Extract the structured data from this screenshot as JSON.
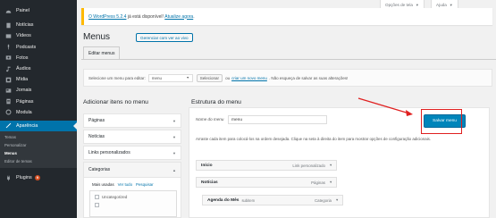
{
  "sidebar": {
    "items": [
      {
        "label": "Painel",
        "icon": "dashboard-icon"
      },
      {
        "label": "Notícias",
        "icon": "pin-icon"
      },
      {
        "label": "Vídeos",
        "icon": "video-icon"
      },
      {
        "label": "Podcasts",
        "icon": "microphone-icon"
      },
      {
        "label": "Fotos",
        "icon": "photo-icon"
      },
      {
        "label": "Áudios",
        "icon": "music-icon"
      },
      {
        "label": "Mídia",
        "icon": "media-icon"
      },
      {
        "label": "Jornais",
        "icon": "newspaper-icon"
      },
      {
        "label": "Páginas",
        "icon": "pages-icon"
      },
      {
        "label": "Modula",
        "icon": "gallery-icon"
      },
      {
        "label": "Aparência",
        "icon": "paintbrush-icon"
      }
    ],
    "submenu": [
      "Temas",
      "Personalizar",
      "Menus",
      "Editor de temas"
    ],
    "plugins": {
      "label": "Plugins",
      "badge": "9"
    }
  },
  "top_tabs": {
    "screen_options": "Opções de tela",
    "help": "Ajuda"
  },
  "notice": {
    "link": "O WordPress 5.2.4",
    "text_mid": " já está disponível! ",
    "action": "Atualize agora",
    "end": "."
  },
  "page": {
    "title": "Menus",
    "preview_button": "Gerenciar com ver ao vivo"
  },
  "tabs": {
    "edit_menus": "Editar menus"
  },
  "select_bar": {
    "prefix": "Selecione um menu para editar:",
    "selected": "menu",
    "select_button": "Selecionar",
    "or": "ou",
    "create_link": "criar um novo menu",
    "suffix": ". Não esqueça de salvar as suas alterações!"
  },
  "left": {
    "heading": "Adicionar itens no menu",
    "sections": [
      "Páginas",
      "Notícias",
      "Links personalizados",
      "Categorias"
    ],
    "tabs": [
      "Mais usadas",
      "Ver tudo",
      "Pesquisar"
    ],
    "check_item": "Uncategorized"
  },
  "right": {
    "heading": "Estrutura do menu",
    "menu_name_label": "Nome do menu",
    "menu_name_value": "menu",
    "save_button": "Salvar menu",
    "instructions": "Arraste cada item para colocá-los na ordem desejada. Clique na seta à direita do item para mostrar opções de configuração adicionais.",
    "items": [
      {
        "title": "Início",
        "type": "Link personalizado"
      },
      {
        "title": "Notícias",
        "type": "Páginas"
      },
      {
        "title": "Agenda do Mês",
        "subtitle": "subitem",
        "type": "Categoria"
      }
    ]
  },
  "colors": {
    "sidebar": "#23282d",
    "accent": "#0073aa",
    "save_button": "#0085ba",
    "highlight": "#e02020"
  }
}
